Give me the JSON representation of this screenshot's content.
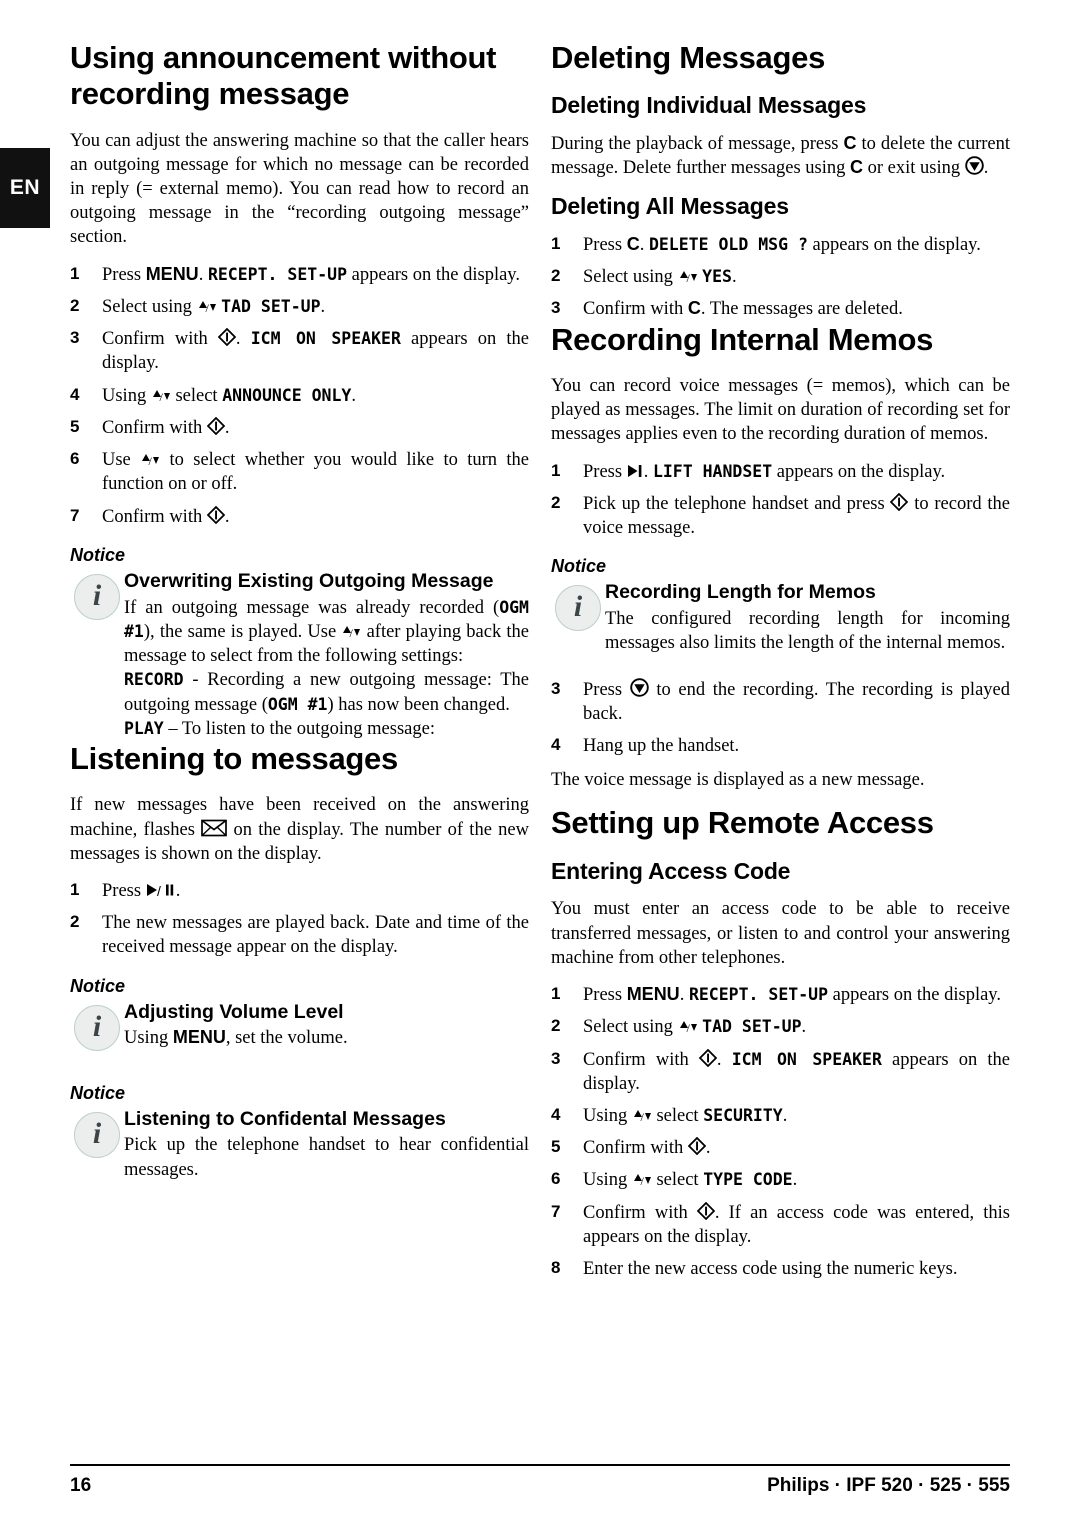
{
  "language_tab": "EN",
  "footer": {
    "page_number": "16",
    "brand_line": "Philips · IPF 520 · 525 · 555"
  },
  "left_column": {
    "heading_announcement": "Using announcement without recording message",
    "intro_paragraph": "You can adjust the answering machine so that the caller hears an outgoing message for which no message can be recorded in reply (= external memo). You can read how to record an outgoing message in the “recording outgoing message” section.",
    "steps": {
      "s1_a": "Press ",
      "s1_key": "MENU",
      "s1_b": ". ",
      "s1_disp": "RECEPT. SET-UP",
      "s1_c": " appears on the display.",
      "s2_a": "Select using ",
      "s2_disp": "TAD SET-UP",
      "s2_b": ".",
      "s3_a": "Confirm with ",
      "s3_b": ". ",
      "s3_disp": "ICM ON SPEAKER",
      "s3_c": " appears on the display.",
      "s4_a": "Using ",
      "s4_b": " select ",
      "s4_disp": "ANNOUNCE ONLY",
      "s4_c": ".",
      "s5_a": "Confirm with ",
      "s5_b": ".",
      "s6_a": "Use ",
      "s6_b": " to select whether you would like to turn the function on or off.",
      "s7_a": "Confirm with ",
      "s7_b": "."
    },
    "notice_overwriting": {
      "label": "Notice",
      "title": "Overwriting Existing Outgoing Message",
      "p1_a": "If an outgoing message was already recorded (",
      "p1_ogm1": "OGM #1",
      "p1_b": "), the same is played. Use ",
      "p1_c": " after playing back the message to select from the following settings:",
      "p2_record": "RECORD",
      "p2_a": " - Recording a new outgoing message: The outgoing message (",
      "p2_ogm1": "OGM #1",
      "p2_b": ") has now been changed.",
      "p3_play": "PLAY",
      "p3_a": " – To listen to the outgoing message:"
    },
    "heading_listening": "Listening to messages",
    "listening_intro_a": "If new messages have been received on the answering machine, flashes ",
    "listening_intro_b": " on the display. The number of the new messages is shown on the display.",
    "listening_steps": {
      "s1_a": "Press ",
      "s1_b": ".",
      "s2": "The new messages are played back. Date and time of the received message appear on the display."
    },
    "notice_volume": {
      "label": "Notice",
      "title": "Adjusting Volume Level",
      "text_a": "Using ",
      "text_key": "MENU",
      "text_b": ", set the volume."
    },
    "notice_confidential": {
      "label": "Notice",
      "title": "Listening to Confidental Messages",
      "text": "Pick up the telephone handset to hear confidential messages."
    }
  },
  "right_column": {
    "heading_deleting": "Deleting Messages",
    "sub_deleting_individual": "Deleting Individual Messages",
    "deleting_individual_text_a": "During the playback of message, press ",
    "deleting_individual_key_c": "C",
    "deleting_individual_text_b": " to delete the current message. Delete further messages using ",
    "deleting_individual_key_c2": "C",
    "deleting_individual_text_c": " or exit using ",
    "deleting_individual_text_d": ".",
    "sub_deleting_all": "Deleting All Messages",
    "deleting_all_steps": {
      "s1_a": "Press ",
      "s1_key": "C",
      "s1_b": ". ",
      "s1_disp": "DELETE OLD MSG ?",
      "s1_c": " appears on the display.",
      "s2_a": "Select using ",
      "s2_disp": "YES",
      "s2_b": ".",
      "s3_a": "Confirm with ",
      "s3_key": "C",
      "s3_b": ". The messages are deleted."
    },
    "heading_memos": "Recording Internal Memos",
    "memos_intro": "You can record voice messages (= memos), which can be played as messages. The limit on duration of recording set for messages applies even to the recording duration of memos.",
    "memos_steps": {
      "s1_a": "Press ",
      "s1_b": ". ",
      "s1_disp": "LIFT HANDSET",
      "s1_c": " appears on the display.",
      "s2_a": "Pick up the telephone handset and press ",
      "s2_b": " to record the voice message.",
      "s3_a": "Press ",
      "s3_b": " to end the recording. The recording is played back.",
      "s4": "Hang up the handset."
    },
    "notice_recording_length": {
      "label": "Notice",
      "title": "Recording Length for Memos",
      "text": "The configured recording length for incoming messages also limits the length of the internal memos."
    },
    "memos_outro": "The voice message is displayed as a new message.",
    "heading_remote": "Setting up Remote Access",
    "sub_access_code": "Entering Access Code",
    "access_intro": "You must enter an access code to be able to receive transferred messages, or listen to and control your answering machine from other telephones.",
    "access_steps": {
      "s1_a": "Press ",
      "s1_key": "MENU",
      "s1_b": ". ",
      "s1_disp": "RECEPT. SET-UP",
      "s1_c": " appears on the display.",
      "s2_a": "Select using ",
      "s2_disp": "TAD SET-UP",
      "s2_b": ".",
      "s3_a": "Confirm with ",
      "s3_b": ". ",
      "s3_disp": "ICM ON SPEAKER",
      "s3_c": " appears on the display.",
      "s4_a": "Using ",
      "s4_b": " select ",
      "s4_disp": "SECURITY",
      "s4_c": ".",
      "s5_a": "Confirm with ",
      "s5_b": ".",
      "s6_a": "Using ",
      "s6_b": " select ",
      "s6_disp": "TYPE CODE",
      "s6_c": ".",
      "s7_a": "Confirm with ",
      "s7_b": ". If an access code was entered, this appears on the display.",
      "s8": "Enter the new access code using the numeric keys."
    }
  },
  "icons": {
    "record": "record-diamond-icon",
    "stop": "stop-circle-icon",
    "play_pause": "play-pause-icon",
    "play_skip": "play-skip-icon",
    "up_down": "up-down-arrows-icon",
    "envelope": "envelope-icon",
    "info": "info-icon"
  },
  "colors": {
    "tab_bg": "#111111",
    "icon_circle_bg": "#eceeee",
    "icon_circle_border": "#bcd0d0",
    "icon_letter": "#3b4446"
  }
}
